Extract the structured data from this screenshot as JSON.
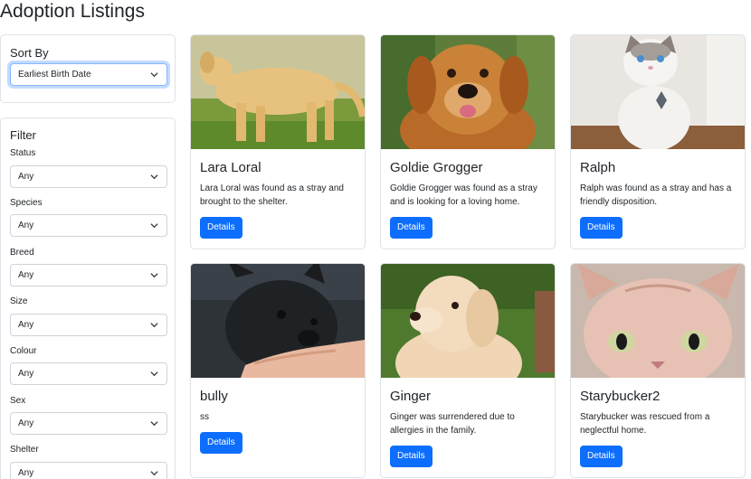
{
  "page": {
    "title": "Adoption Listings"
  },
  "sort": {
    "title": "Sort By",
    "selected": "Earliest Birth Date"
  },
  "filter": {
    "title": "Filter",
    "fields": [
      {
        "label": "Status",
        "value": "Any"
      },
      {
        "label": "Species",
        "value": "Any"
      },
      {
        "label": "Breed",
        "value": "Any"
      },
      {
        "label": "Size",
        "value": "Any"
      },
      {
        "label": "Colour",
        "value": "Any"
      },
      {
        "label": "Sex",
        "value": "Any"
      },
      {
        "label": "Shelter",
        "value": "Any"
      }
    ]
  },
  "listings": [
    {
      "name": "Lara Loral",
      "description": "Lara Loral was found as a stray and brought to the shelter.",
      "button": "Details"
    },
    {
      "name": "Goldie Grogger",
      "description": "Goldie Grogger was found as a stray and is looking for a loving home.",
      "button": "Details"
    },
    {
      "name": "Ralph",
      "description": "Ralph was found as a stray and has a friendly disposition.",
      "button": "Details"
    },
    {
      "name": "bully",
      "description": "ss",
      "button": "Details"
    },
    {
      "name": "Ginger",
      "description": "Ginger was surrendered due to allergies in the family.",
      "button": "Details"
    },
    {
      "name": "Starybucker2",
      "description": "Starybucker was rescued from a neglectful home.",
      "button": "Details"
    }
  ],
  "colors": {
    "primary": "#0d6efd",
    "border": "#dee2e6",
    "text": "#212529"
  }
}
